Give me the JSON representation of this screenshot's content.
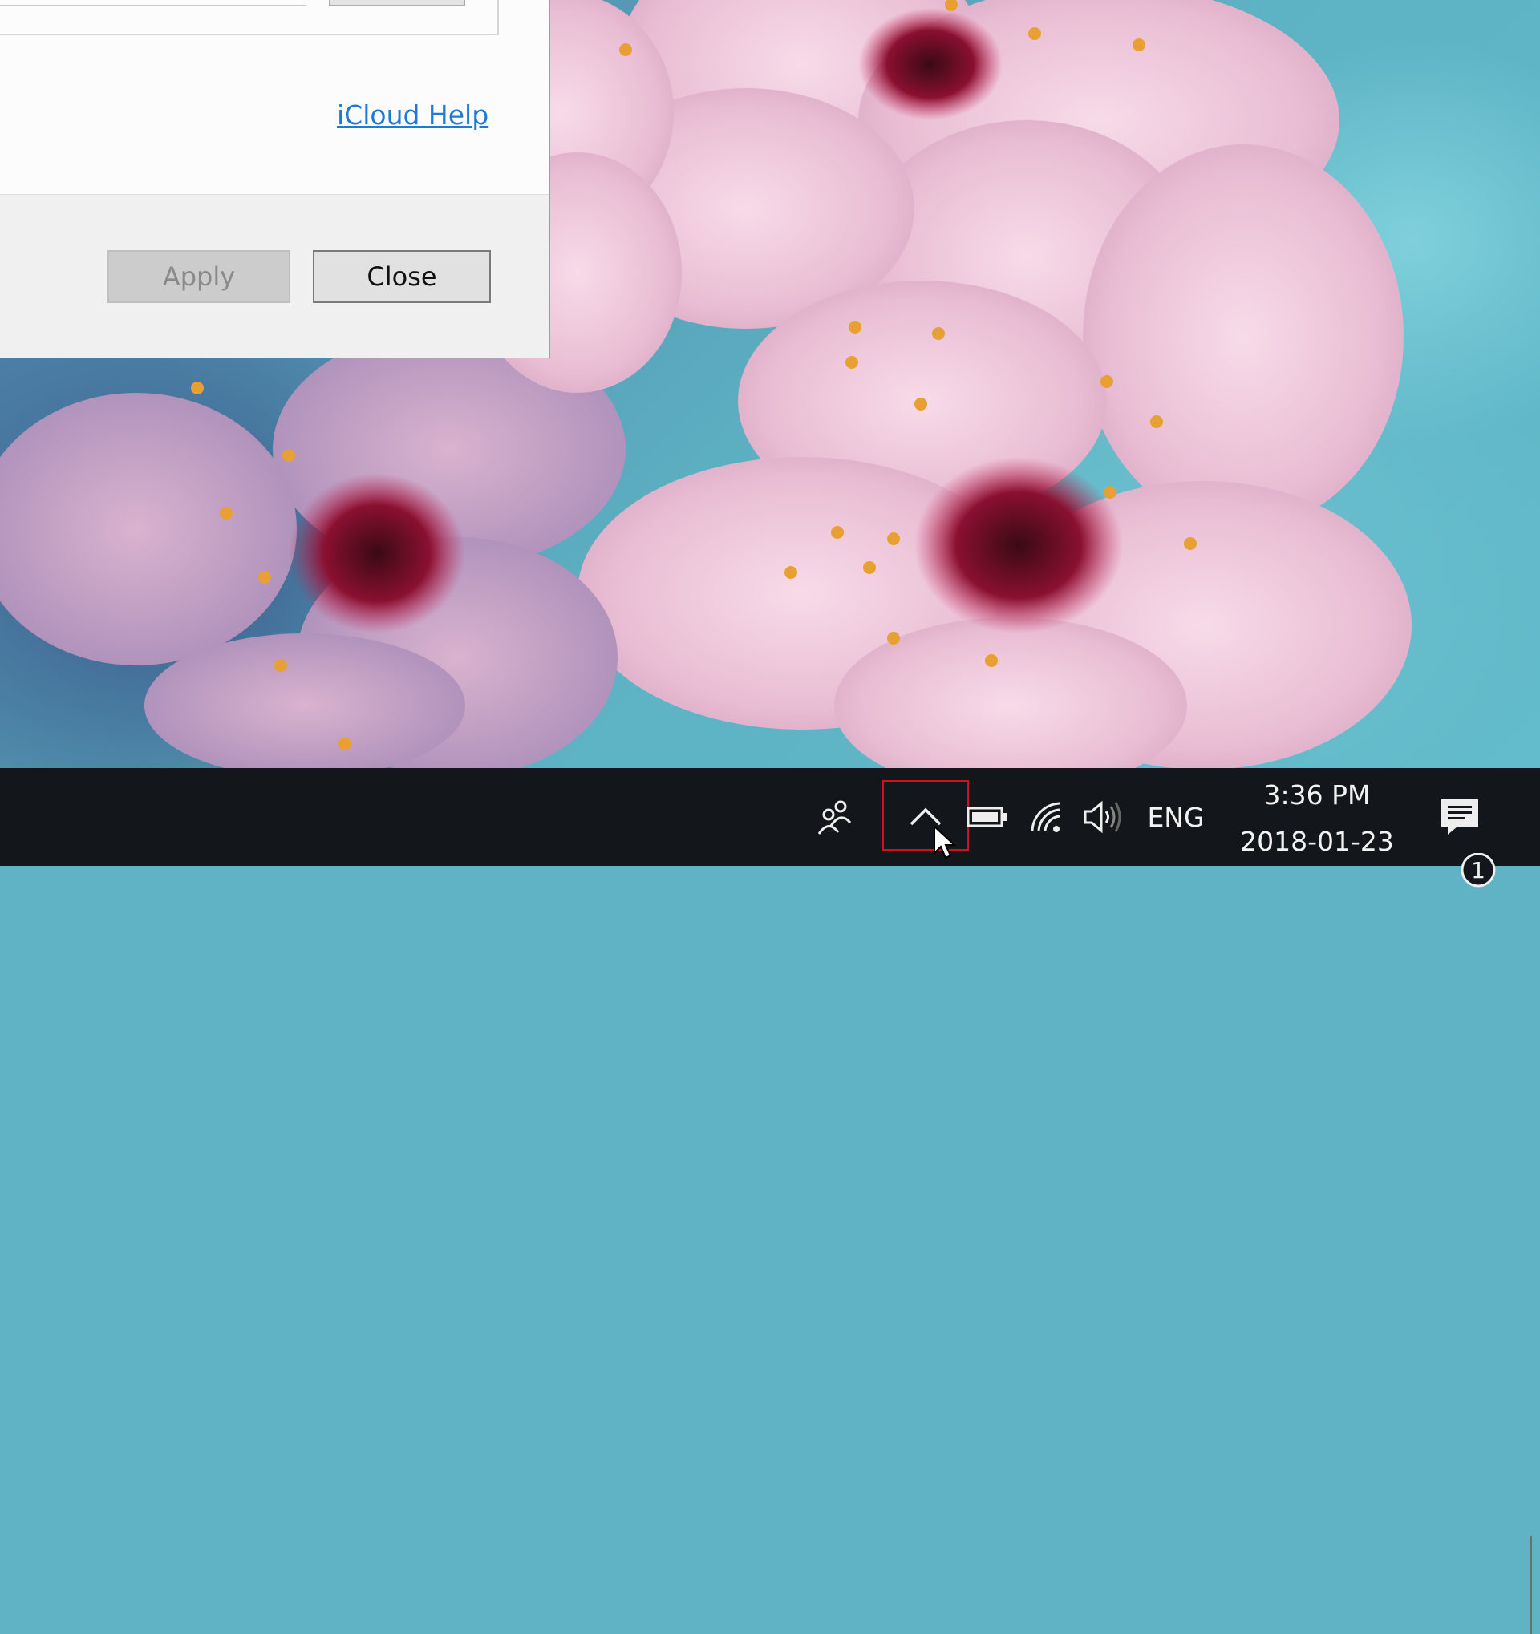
{
  "dialog": {
    "help_link": "iCloud Help",
    "apply_label": "Apply",
    "close_label": "Close"
  },
  "taskbar": {
    "icons": {
      "people": "people-icon",
      "show_hidden": "chevron-up-icon",
      "battery": "battery-icon",
      "network": "wifi-icon",
      "volume": "volume-icon",
      "notifications": "action-center-icon"
    },
    "language": "ENG",
    "time": "3:36 PM",
    "date": "2018-01-23",
    "notification_count": "1",
    "highlight_color": "#d0121c"
  }
}
